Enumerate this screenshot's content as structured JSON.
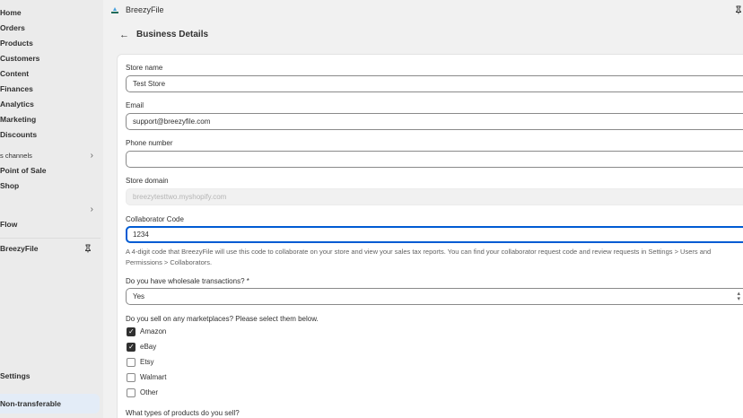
{
  "sidebar": {
    "items": [
      {
        "label": "Home"
      },
      {
        "label": "Orders"
      },
      {
        "label": "Products"
      },
      {
        "label": "Customers"
      },
      {
        "label": "Content"
      },
      {
        "label": "Finances"
      },
      {
        "label": "Analytics"
      },
      {
        "label": "Marketing"
      },
      {
        "label": "Discounts"
      }
    ],
    "channels_label": "s channels",
    "channels": [
      {
        "label": "Point of Sale"
      },
      {
        "label": "Shop"
      }
    ],
    "apps_label": "",
    "apps": [
      {
        "label": "Flow"
      }
    ],
    "pinned_app": "BreezyFile",
    "settings_label": "Settings",
    "footer_label": "Non-transferable"
  },
  "topbar": {
    "app_name": "BreezyFile",
    "icons": [
      "breezyfile-logo",
      "pin-icon"
    ]
  },
  "page": {
    "back_icon": "←",
    "title": "Business Details"
  },
  "form": {
    "store_name": {
      "label": "Store name",
      "value": "Test Store"
    },
    "email": {
      "label": "Email",
      "value": "support@breezyfile.com"
    },
    "phone": {
      "label": "Phone number",
      "value": ""
    },
    "store_domain": {
      "label": "Store domain",
      "value": "breezytesttwo.myshopify.com"
    },
    "collaborator_code": {
      "label": "Collaborator Code",
      "value": "1234",
      "help": "A 4-digit code that BreezyFile will use this code to collaborate on your store and view your sales tax reports. You can find your collaborator request code and review requests in Settings > Users and Permissions > Collaborators."
    },
    "wholesale": {
      "label": "Do you have wholesale transactions? *",
      "value": "Yes"
    },
    "marketplaces": {
      "label": "Do you sell on any marketplaces? Please select them below.",
      "options": [
        {
          "label": "Amazon",
          "checked": true
        },
        {
          "label": "eBay",
          "checked": true
        },
        {
          "label": "Etsy",
          "checked": false
        },
        {
          "label": "Walmart",
          "checked": false
        },
        {
          "label": "Other",
          "checked": false
        }
      ]
    },
    "product_types": {
      "label": "What types of products do you sell?"
    }
  },
  "colors": {
    "accent": "#005bd3",
    "sidebar_bg": "#ebebeb",
    "page_bg": "#f1f1f1",
    "text": "#303030"
  }
}
